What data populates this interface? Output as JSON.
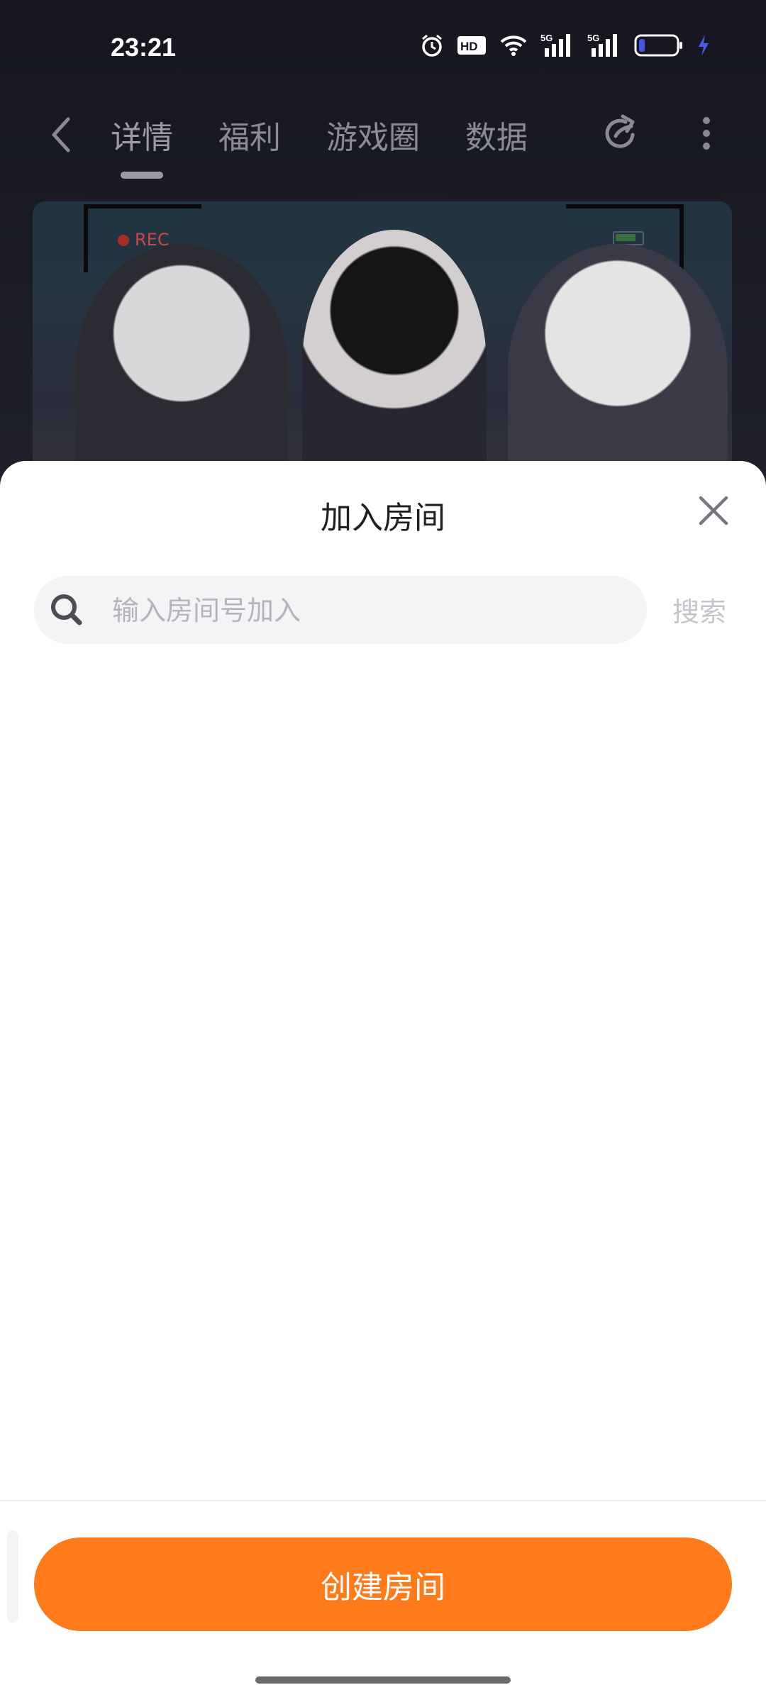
{
  "status_bar": {
    "time": "23:21",
    "icons": [
      "alarm-icon",
      "hd-icon",
      "wifi-icon",
      "signal-5g-icon",
      "signal-5g-icon",
      "battery-icon",
      "charging-icon"
    ],
    "network_1": "5G",
    "network_2": "5G",
    "hd_label": "HD"
  },
  "nav": {
    "tabs": [
      {
        "label": "详情",
        "active": true
      },
      {
        "label": "福利",
        "active": false
      },
      {
        "label": "游戏圈",
        "active": false
      },
      {
        "label": "数据",
        "active": false
      }
    ]
  },
  "banner": {
    "rec_label": "REC"
  },
  "sheet": {
    "title": "加入房间",
    "search": {
      "placeholder": "输入房间号加入",
      "value": "",
      "button_label": "搜索"
    },
    "create_button_label": "创建房间"
  },
  "colors": {
    "accent": "#ff7a1a",
    "sheet_bg": "#ffffff",
    "search_bg": "#f4f4f6"
  }
}
